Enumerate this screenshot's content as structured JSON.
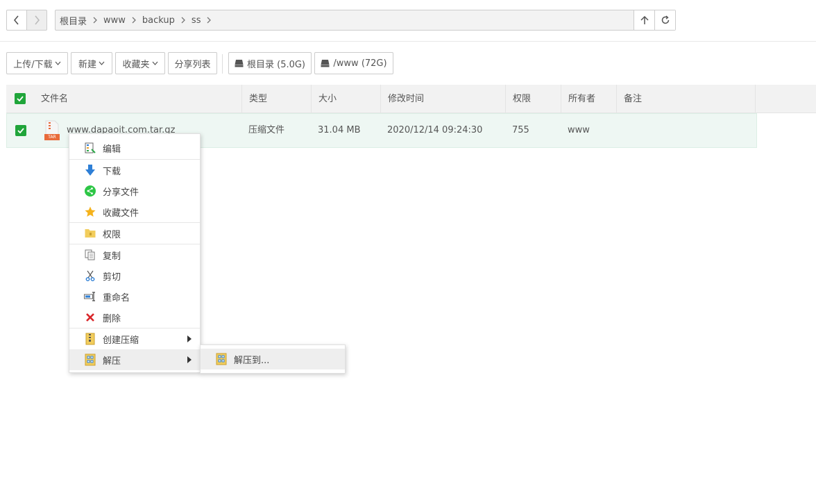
{
  "nav": {
    "back_icon": "chevron-left-icon",
    "forward_icon": "chevron-right-icon",
    "breadcrumbs": [
      "根目录",
      "www",
      "backup",
      "ss"
    ],
    "up_icon": "arrow-up-icon",
    "refresh_icon": "refresh-icon"
  },
  "toolbar": {
    "upload_label": "上传/下载",
    "new_label": "新建",
    "favorites_label": "收藏夹",
    "share_list_label": "分享列表",
    "disk_root_label": "根目录 (5.0G)",
    "disk_www_label": "/www (72G)"
  },
  "table": {
    "headers": {
      "name": "文件名",
      "type": "类型",
      "size": "大小",
      "mtime": "修改时间",
      "perm": "权限",
      "owner": "所有者",
      "note": "备注"
    },
    "rows": [
      {
        "name": "www.dapaoit.com.tar.gz",
        "icon_text": "TAR",
        "type": "压缩文件",
        "size": "31.04 MB",
        "mtime": "2020/12/14 09:24:30",
        "perm": "755",
        "owner": "www",
        "note": ""
      }
    ]
  },
  "context_menu": {
    "edit": "编辑",
    "download": "下载",
    "share": "分享文件",
    "favorite": "收藏文件",
    "permission": "权限",
    "copy": "复制",
    "cut": "剪切",
    "rename": "重命名",
    "delete": "删除",
    "compress": "创建压缩",
    "extract": "解压"
  },
  "submenu": {
    "extract_to": "解压到..."
  },
  "colors": {
    "accent": "#20a53a",
    "row_selected": "#eef7f3",
    "delete_red": "#d9262a"
  }
}
